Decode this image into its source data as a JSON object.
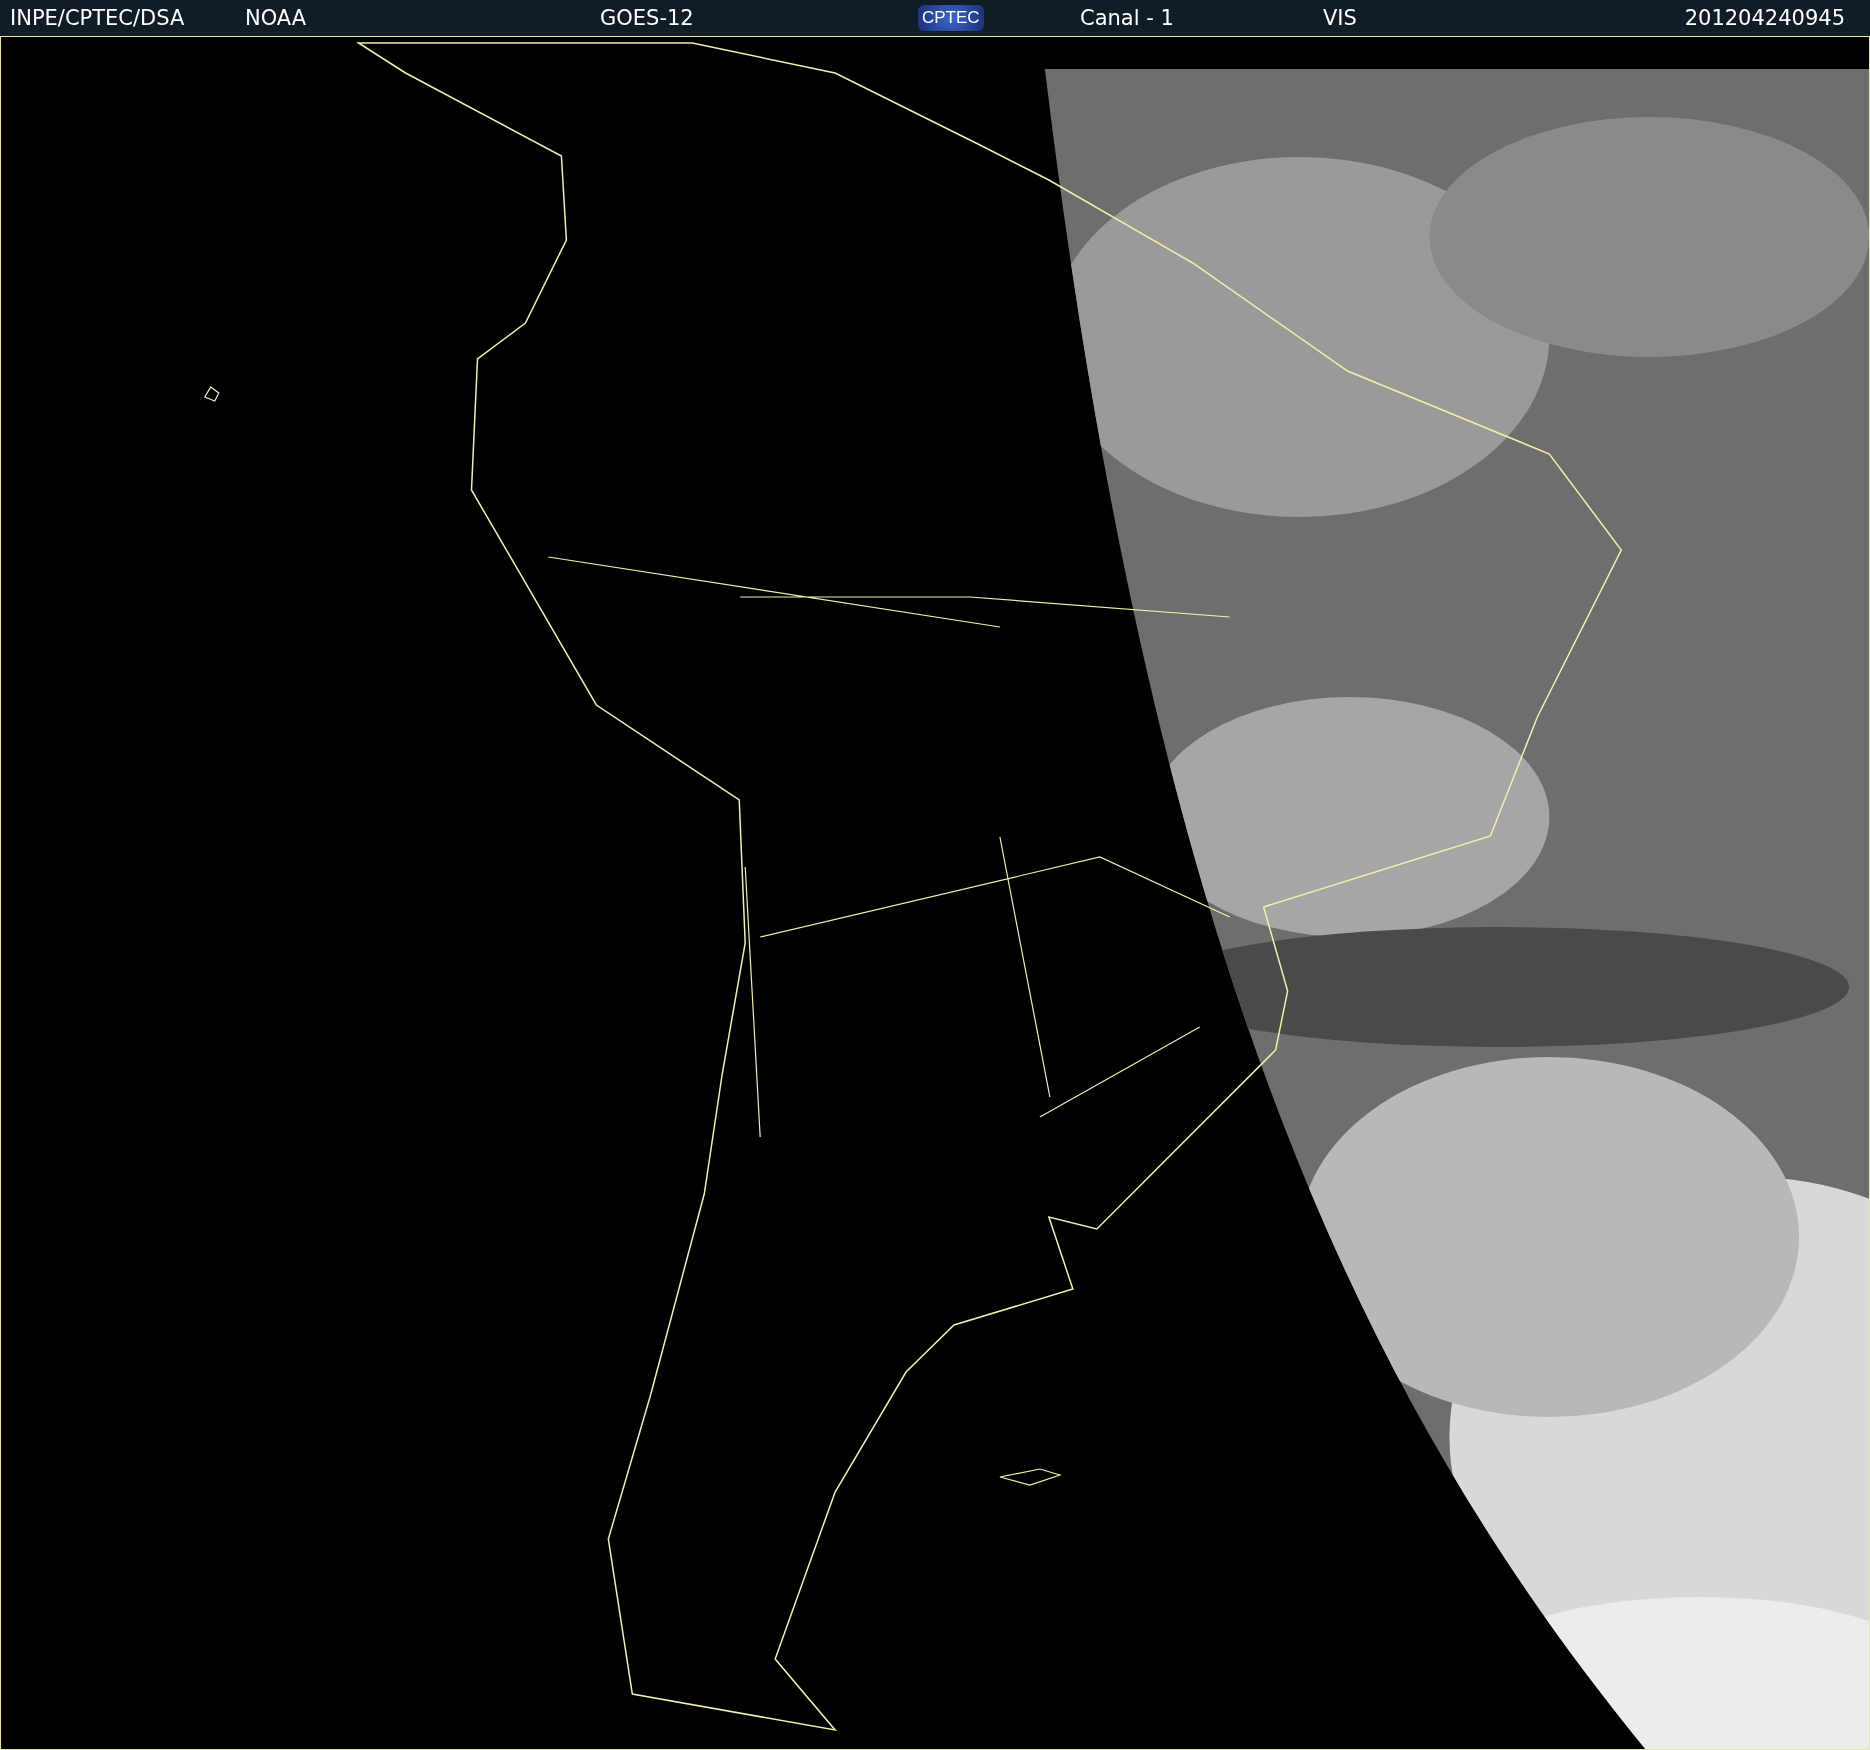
{
  "header": {
    "items": [
      {
        "kind": "text",
        "text": "INPE/CPTEC/DSA"
      },
      {
        "kind": "text",
        "text": "NOAA"
      },
      {
        "kind": "text",
        "text": "GOES-12"
      },
      {
        "kind": "logo",
        "text": "CPTEC"
      },
      {
        "kind": "text",
        "text": "Canal - 1"
      },
      {
        "kind": "text",
        "text": "VIS"
      },
      {
        "kind": "text",
        "text": "201204240945"
      }
    ]
  }
}
